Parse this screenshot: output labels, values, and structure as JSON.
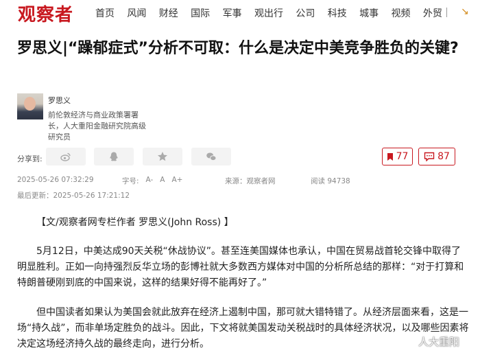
{
  "site": {
    "logo": "观察者"
  },
  "nav": {
    "items": [
      "首页",
      "风闻",
      "财经",
      "国际",
      "军事",
      "观出行",
      "公司",
      "科技",
      "城事",
      "视频",
      "外贸"
    ]
  },
  "article": {
    "title": "罗思义|“躁郁症式”分析不可取：什么是决定中美竞争胜负的关键?",
    "author": {
      "name": "罗思义",
      "bio": "前伦敦经济与商业政策署署长，人大重阳金融研究院高级研究员"
    },
    "share_label": "分享到:",
    "share_icons": [
      "weibo-icon",
      "qq-icon",
      "qzone-icon",
      "wechat-icon"
    ],
    "favorites_count": "77",
    "comments_count": "87",
    "published": "2025-05-26 07:32:29",
    "font_size_label": "字号:",
    "font_size_options": [
      "A-",
      "A",
      "A+"
    ],
    "source": "来源：观察者网",
    "views": "阅读 94738",
    "last_updated": "最后更新：2025-05-26 17:21:12",
    "paragraphs": [
      "【文/观察者网专栏作者 罗思义(John Ross) 】",
      "5月12日，中美达成90天关税“休战协议”。甚至连美国媒体也承认，中国在贸易战首轮交锋中取得了明显胜利。正如一向持强烈反华立场的彭博社就大多数西方媒体对中国的分析所总结的那样：“对于打算和特朗普硬刚到底的中国来说，这样的结果好得不能再好了。”",
      "但中国读者如果认为美国会就此放弃在经济上遏制中国，那可就大错特错了。从经济层面来看，这是一场“持久战”，而非单场定胜负的战斗。因此，下文将就美国发动关税战时的具体经济状况，以及哪些因素将决定这场经济持久战的最终走向，进行分析。"
    ],
    "watermark": "人大重阳"
  },
  "colors": {
    "brand": "#c8181f",
    "meta": "#888888"
  }
}
